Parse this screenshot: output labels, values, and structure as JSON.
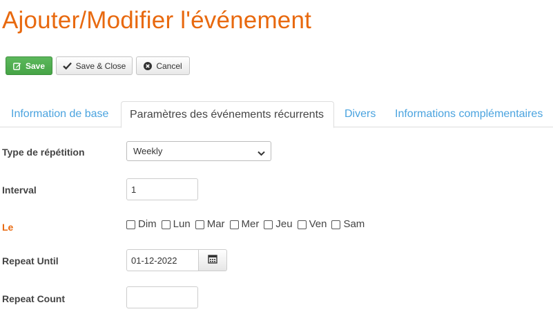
{
  "page": {
    "title": "Ajouter/Modifier l'événement"
  },
  "toolbar": {
    "save_label": "Save",
    "save_close_label": "Save & Close",
    "cancel_label": "Cancel"
  },
  "tabs": [
    {
      "label": "Information de base",
      "active": false
    },
    {
      "label": "Paramètres des événements récurrents",
      "active": true
    },
    {
      "label": "Divers",
      "active": false
    },
    {
      "label": "Informations complémentaires",
      "active": false
    }
  ],
  "form": {
    "repeat_type": {
      "label": "Type de répétition",
      "value": "Weekly"
    },
    "interval": {
      "label": "Interval",
      "value": "1"
    },
    "on_days": {
      "label": "Le",
      "days": [
        "Dim",
        "Lun",
        "Mar",
        "Mer",
        "Jeu",
        "Ven",
        "Sam"
      ],
      "checked": [
        false,
        false,
        false,
        false,
        false,
        false,
        false
      ]
    },
    "repeat_until": {
      "label": "Repeat Until",
      "value": "01-12-2022"
    },
    "repeat_count": {
      "label": "Repeat Count",
      "value": ""
    }
  },
  "colors": {
    "title": "#e8690f",
    "required_label": "#e8690f",
    "save_button": "#5cb85c",
    "tab_link": "#4aa3df"
  },
  "icons": {
    "save": "edit-icon",
    "save_close": "check-icon",
    "cancel": "x-circle-icon",
    "date": "calendar-icon",
    "select": "chevron-down-icon"
  }
}
